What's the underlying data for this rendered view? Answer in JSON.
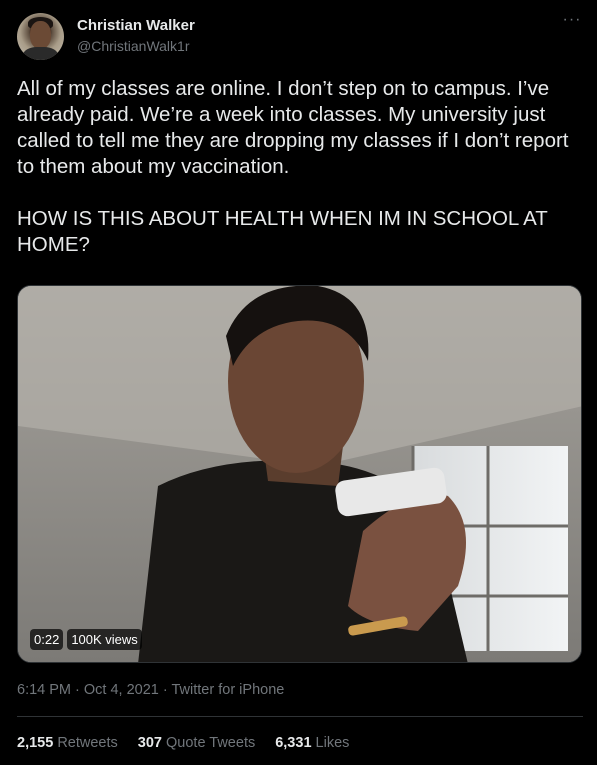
{
  "author": {
    "name": "Christian Walker",
    "handle": "@ChristianWalk1r"
  },
  "tweet": {
    "text": "All of my classes are online. I don’t step on to campus. I’ve already paid. We’re a week into classes. My university just called to tell me they are dropping my classes if I don’t report to them about my vaccination.\n\nHOW IS THIS ABOUT HEALTH WHEN IM IN SCHOOL AT HOME?",
    "timestamp": "6:14 PM · Oct 4, 2021",
    "source": "Twitter for iPhone"
  },
  "video": {
    "duration": "0:22",
    "views": "100K views"
  },
  "stats": {
    "retweets_count": "2,155",
    "retweets_label": "Retweets",
    "quotes_count": "307",
    "quotes_label": "Quote Tweets",
    "likes_count": "6,331",
    "likes_label": "Likes"
  },
  "icons": {
    "more": "more-options-icon"
  },
  "colors": {
    "background": "#000000",
    "text_primary": "#e7e9ea",
    "text_secondary": "#71767b",
    "divider": "#2f3336"
  }
}
